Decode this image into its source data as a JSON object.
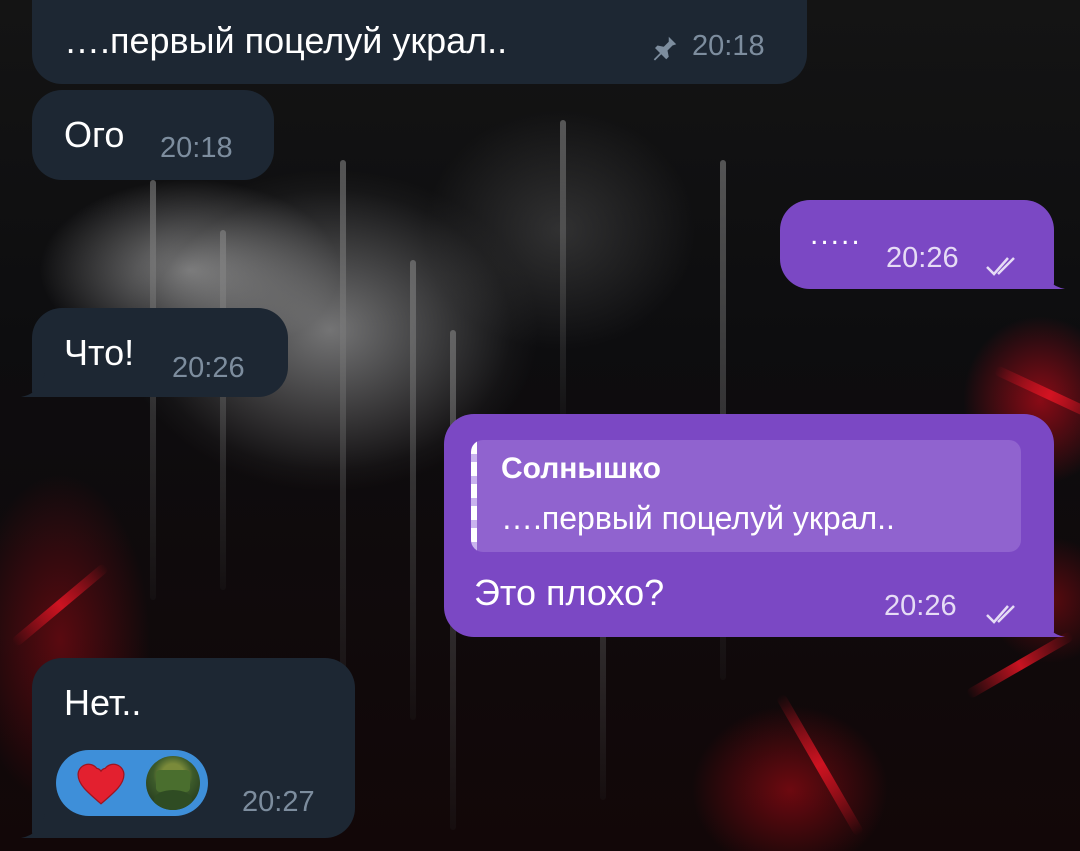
{
  "messages": [
    {
      "id": "m1",
      "side": "in",
      "text": "….первый поцелуй украл..",
      "time": "20:18",
      "icon": "pin-icon"
    },
    {
      "id": "m2",
      "side": "in",
      "text": "Ого",
      "time": "20:18"
    },
    {
      "id": "m3",
      "side": "out",
      "text": ".....",
      "time": "20:26",
      "status": "read-double-check"
    },
    {
      "id": "m4",
      "side": "in",
      "text": "Что!",
      "time": "20:26"
    },
    {
      "id": "m5",
      "side": "out",
      "reply": {
        "name": "Солнышко",
        "text": "….первый поцелуй украл.."
      },
      "text": "Это плохо?",
      "time": "20:26",
      "status": "read-double-check"
    },
    {
      "id": "m6",
      "side": "in",
      "text": "Нет..",
      "time": "20:27",
      "reactions": [
        "heart-emoji",
        "user-avatar"
      ]
    }
  ],
  "colors": {
    "incoming_bubble": "#1d2733",
    "outgoing_bubble": "#7b48c4",
    "reply_block": "#9063cf",
    "reaction_pill": "#3e8fd9",
    "heart": "#e3202f"
  }
}
